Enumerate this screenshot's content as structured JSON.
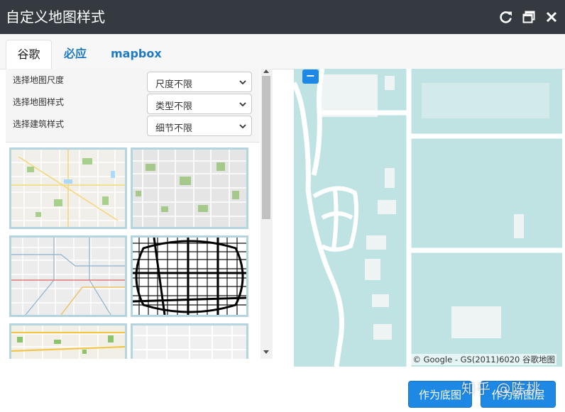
{
  "window": {
    "title": "自定义地图样式"
  },
  "titlebar_icons": [
    "refresh-icon",
    "restore-icon",
    "close-icon"
  ],
  "tabs": [
    {
      "label": "谷歌",
      "active": true
    },
    {
      "label": "必应",
      "active": false
    },
    {
      "label": "mapbox",
      "active": false
    }
  ],
  "filters": [
    {
      "label": "选择地图尺度",
      "value": "尺度不限"
    },
    {
      "label": "选择地图样式",
      "value": "类型不限"
    },
    {
      "label": "选择建筑样式",
      "value": "细节不限"
    }
  ],
  "map": {
    "zoom_out_label": "−",
    "attribution": "© Google - GS(2011)6020 谷歌地图"
  },
  "buttons": {
    "as_base": "作为底图",
    "as_new_layer": "作为新图层"
  },
  "watermark": "知乎 @陈桃",
  "colors": {
    "titlebar": "#353a40",
    "accent": "#1e88e5",
    "tab_link": "#1e7ac4",
    "thumb_border": "#b4d4e0",
    "map_water": "#bfe3e3"
  }
}
